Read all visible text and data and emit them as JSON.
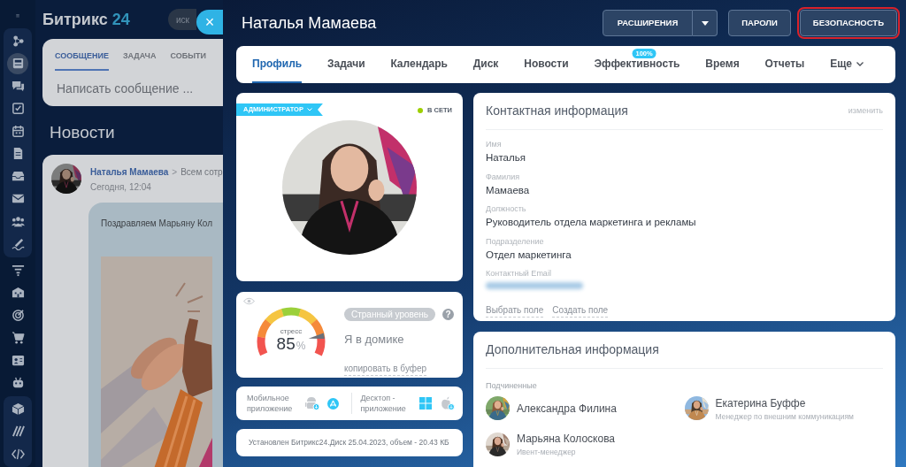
{
  "background": {
    "sidebar_icons": [
      {
        "selected": false
      },
      {
        "selected": true
      },
      {
        "selected": false
      },
      {
        "selected": false
      },
      {
        "selected": false
      },
      {
        "selected": false
      },
      {
        "selected": false
      },
      {
        "selected": false
      },
      {
        "selected": false
      },
      {
        "selected": false
      },
      {
        "selected": false
      },
      {
        "selected": false
      },
      {
        "selected": false
      },
      {
        "selected": false
      },
      {
        "selected": false
      },
      {
        "selected": false
      },
      {
        "selected": false
      },
      {
        "selected": false
      },
      {
        "selected": false
      }
    ],
    "logo": {
      "name": "Битрикс",
      "number": "24"
    },
    "search": {
      "placeholder": "иск"
    },
    "composer": {
      "tabs": [
        {
          "label": "СООБЩЕНИЕ",
          "selected": true
        },
        {
          "label": "ЗАДАЧА",
          "selected": false
        },
        {
          "label": "СОБЫТИ",
          "selected": false
        }
      ],
      "placeholder": "Написать сообщение ..."
    },
    "heading": "Новости",
    "post": {
      "author": "Наталья Мамаева",
      "separator": ">",
      "recipients": "Всем сотр",
      "time": "Сегодня, 12:04",
      "text": "Поздравляем Марьяну Кол"
    }
  },
  "slider": {
    "close": "×",
    "title": "Наталья Мамаева",
    "buttons": [
      {
        "label": "РАСШИРЕНИЯ",
        "kind": "split",
        "highlighted": false
      },
      {
        "label": "ПАРОЛИ",
        "kind": "plain",
        "highlighted": false
      },
      {
        "label": "БЕЗОПАСНОСТЬ",
        "kind": "plain",
        "highlighted": true
      }
    ],
    "tabs": [
      {
        "label": "Профиль",
        "selected": true
      },
      {
        "label": "Задачи",
        "selected": false
      },
      {
        "label": "Календарь",
        "selected": false
      },
      {
        "label": "Диск",
        "selected": false
      },
      {
        "label": "Новости",
        "selected": false
      },
      {
        "label": "Эффективность",
        "badge": "100%",
        "selected": false
      },
      {
        "label": "Время",
        "selected": false
      },
      {
        "label": "Отчеты",
        "selected": false
      },
      {
        "label": "Еще",
        "dropdown": true,
        "selected": false
      }
    ],
    "profile": {
      "role": "АДМИНИСТРАТОР",
      "status": "В СЕТИ",
      "online": true
    },
    "stress": {
      "caption": "стресс",
      "value": "85",
      "unit": "%",
      "badge": "Странный уровень",
      "help": "?",
      "status": "Я в домике",
      "copy_link": "копировать в буфер"
    },
    "apps": [
      {
        "label": "Мобильное приложение",
        "kind": "mobile"
      },
      {
        "label": "Десктоп - приложение",
        "kind": "desktop"
      }
    ],
    "disk": "Установлен Битрикс24.Диск 25.04.2023, объем - 20.43 КБ",
    "contact": {
      "title": "Контактная информация",
      "edit": "изменить",
      "fields": [
        {
          "label": "Имя",
          "value": "Наталья"
        },
        {
          "label": "Фамилия",
          "value": "Мамаева"
        },
        {
          "label": "Должность",
          "value": "Руководитель отдела маркетинга и рекламы"
        },
        {
          "label": "Подразделение",
          "value": "Отдел маркетинга"
        },
        {
          "label": "Контактный Email",
          "blurred": true
        }
      ],
      "links": [
        "Выбрать поле",
        "Создать поле"
      ]
    },
    "extra": {
      "title": "Дополнительная информация",
      "section": "Подчиненные",
      "people": [
        {
          "name": "Александра Филина"
        },
        {
          "name": "Екатерина Буффе",
          "position": "Менеджер по внешним коммуникациям"
        },
        {
          "name": "Марьяна Колоскова",
          "position": "Ивент-менеджер"
        }
      ]
    }
  }
}
